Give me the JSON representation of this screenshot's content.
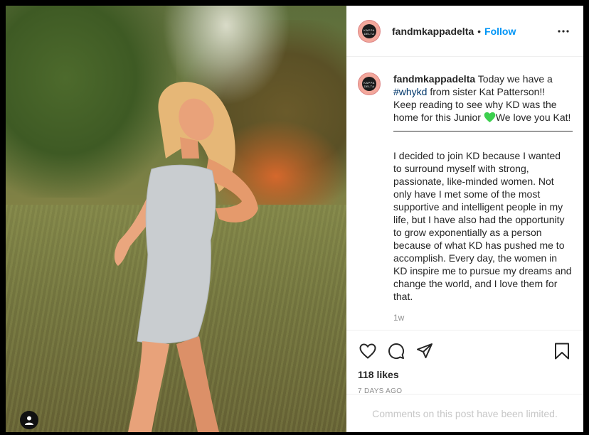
{
  "post": {
    "username": "fandmkappadelta",
    "follow_label": "Follow",
    "avatar_text": "KAPPA DELTA",
    "caption": {
      "username": "fandmkappadelta",
      "line1_text": " Today we have a",
      "hashtag": "#whykd",
      "line2_rest": " from sister Kat Patterson!!",
      "line3": "Keep reading to see why KD was the",
      "line4_pre": "home for this Junior ",
      "line4_post": "We love you Kat!",
      "divider": "——————————————————",
      "para": [
        "I decided to join KD because I wanted",
        "to surround myself with strong,",
        "passionate, like-minded women. Not",
        "only have I met some of the most",
        "supportive and intelligent people in my",
        "life, but I have also had the opportunity",
        "to grow exponentially as a person",
        "because of what KD has pushed me to",
        "accomplish. Every day, the women in",
        "KD inspire me to pursue my dreams and",
        "change the world, and I love them for",
        "that."
      ],
      "time": "1w",
      "emoji": "green-heart-icon"
    },
    "likes": "118 likes",
    "date": "7 DAYS AGO",
    "comments_notice": "Comments on this post have been limited.",
    "icons": [
      "like-heart-icon",
      "comment-icon",
      "share-icon",
      "bookmark-icon",
      "more-icon",
      "user-tag-icon"
    ],
    "colors": {
      "follow": "#0095f6",
      "hashtag": "#00376b",
      "muted": "#8e8e8e",
      "heart": "#3ccf4e"
    }
  }
}
